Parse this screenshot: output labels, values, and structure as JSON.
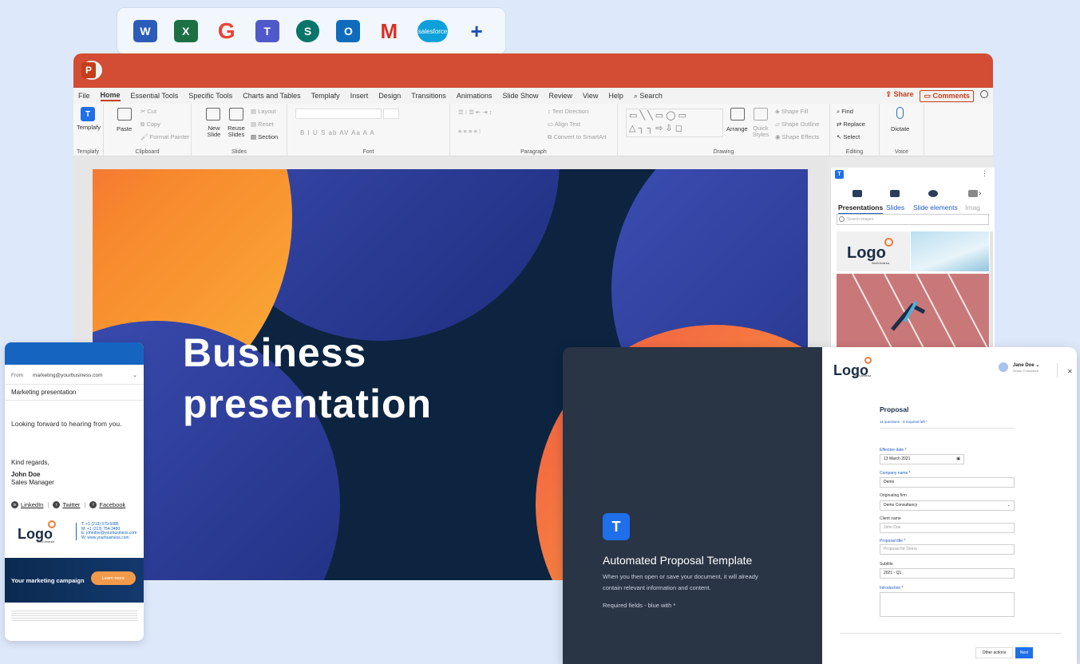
{
  "app_bar": {
    "apps": [
      {
        "label": "W",
        "icon": "word-icon"
      },
      {
        "label": "X",
        "icon": "excel-icon"
      },
      {
        "label": "G",
        "icon": "google-icon"
      },
      {
        "label": "T",
        "icon": "teams-icon"
      },
      {
        "label": "S",
        "icon": "sharepoint-icon"
      },
      {
        "label": "O",
        "icon": "outlook-icon"
      },
      {
        "label": "M",
        "icon": "gmail-icon"
      },
      {
        "label": "salesforce",
        "icon": "salesforce-icon"
      },
      {
        "label": "+",
        "icon": "plus-icon"
      }
    ]
  },
  "powerpoint": {
    "logo": "P",
    "tabs": [
      "File",
      "Home",
      "Essential Tools",
      "Specific Tools",
      "Charts and Tables",
      "Templafy",
      "Insert",
      "Design",
      "Transitions",
      "Animations",
      "Slide Show",
      "Review",
      "View",
      "Help",
      "Search"
    ],
    "active_tab": "Home",
    "share": "Share",
    "comments": "Comments",
    "groups": {
      "templafy": {
        "button": "Templafy",
        "label": "Templafy"
      },
      "clipboard": {
        "paste": "Paste",
        "cut": "Cut",
        "copy": "Copy",
        "format_painter": "Format Painter",
        "label": "Clipboard"
      },
      "slides": {
        "new_slide": "New Slide",
        "reuse_slides": "Reuse Slides",
        "layout": "Layout",
        "reset": "Reset",
        "section": "Section",
        "label": "Slides"
      },
      "font": {
        "label": "Font",
        "format": "B  I  U  S  ab  AV  Aa  A  A"
      },
      "paragraph": {
        "text_direction": "Text Direction",
        "align_text": "Align Text",
        "convert_smartart": "Convert to SmartArt",
        "label": "Paragraph"
      },
      "drawing": {
        "arrange": "Arrange",
        "quick_styles": "Quick Styles",
        "shape_fill": "Shape Fill",
        "shape_outline": "Shape Outline",
        "shape_effects": "Shape Effects",
        "label": "Drawing"
      },
      "editing": {
        "find": "Find",
        "replace": "Replace",
        "select": "Select",
        "label": "Editing"
      },
      "voice": {
        "dictate": "Dictate",
        "label": "Voice"
      }
    }
  },
  "slide": {
    "title_line1": "Business",
    "title_line2": "presentation"
  },
  "templafy_panel": {
    "logo": "T",
    "tabs": [
      "Presentations",
      "Slides",
      "Slide elements",
      "Imag"
    ],
    "active_tab": "Presentations",
    "search_placeholder": "Search images",
    "thumb_logo_text": "Logo",
    "thumb_logo_sub": "North America"
  },
  "email": {
    "from_label": "From",
    "from_value": "marketing@yourbusiness.com",
    "subject": "Marketing presentation",
    "body": "Looking forward to hearing from you.",
    "regards": "Kind regards,",
    "name": "John Doe",
    "role": "Sales Manager",
    "social": [
      "LinkedIn",
      "Twitter",
      "Facebook"
    ],
    "logo_text": "Logo",
    "logo_sub": "North America",
    "contacts": [
      "T: +1 (213) 579-5085",
      "M: +1 (213) 754-3480",
      "E: johndoe@yourbusiness.com",
      "W: www.yourbusiness.com"
    ],
    "banner_text": "Your marketing campaign",
    "banner_button": "Learn more"
  },
  "proposal": {
    "logo_letter": "T",
    "heading": "Automated Proposal Template",
    "description": "When you then open or save your document, it will already contain relevant information and content.",
    "required_note": "Required fields - blue with *",
    "brand_logo": "Logo",
    "brand_sub": "North America",
    "user_name": "Jane Doe",
    "user_role": "Senior Consultant",
    "form_title": "Proposal",
    "progress": "11 questions · 6 required left *",
    "fields": [
      {
        "label": "Effective date *",
        "value": "13 March 2021",
        "required": true,
        "placeholder": false
      },
      {
        "label": "Company name *",
        "value": "Demo",
        "required": true,
        "placeholder": false
      },
      {
        "label": "Originating firm",
        "value": "Demo Consultancy",
        "required": false,
        "placeholder": false
      },
      {
        "label": "Client name",
        "value": "John Doe",
        "required": false,
        "placeholder": true
      },
      {
        "label": "Proposal title *",
        "value": "Proposal for Demo",
        "required": true,
        "placeholder": true
      },
      {
        "label": "Subtitle",
        "value": "2021 - Q1",
        "required": false,
        "placeholder": false
      }
    ],
    "intro_label": "Introduction *",
    "other_actions": "Other actions",
    "next": "Next"
  }
}
